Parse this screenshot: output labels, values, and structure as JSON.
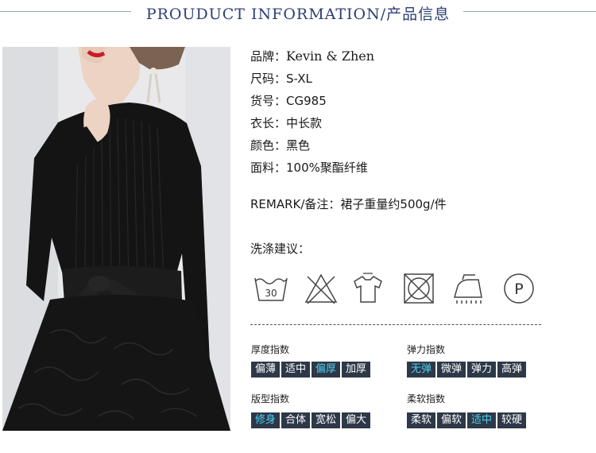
{
  "header": {
    "title": "PROUDUCT INFORMATION/产品信息"
  },
  "specs": [
    {
      "label": "品牌：",
      "value": "Kevin & Zhen"
    },
    {
      "label": "尺码：",
      "value": "S-XL"
    },
    {
      "label": "货号：",
      "value": "CG985"
    },
    {
      "label": "衣长：",
      "value": "中长款"
    },
    {
      "label": "颜色：",
      "value": "黑色"
    },
    {
      "label": "面料：",
      "value": "100%聚酯纤维"
    }
  ],
  "remark": {
    "label": "REMARK/备注：",
    "value": "裙子重量约500g/件"
  },
  "washing": {
    "label": "洗涤建议：",
    "icons": [
      {
        "name": "wash-30-icon",
        "text": "30"
      },
      {
        "name": "no-bleach-icon"
      },
      {
        "name": "dry-flat-icon"
      },
      {
        "name": "no-tumble-dry-icon"
      },
      {
        "name": "low-iron-icon"
      },
      {
        "name": "dry-clean-p-icon",
        "text": "P"
      }
    ]
  },
  "indices": {
    "thickness": {
      "label": "厚度指数",
      "options": [
        "偏薄",
        "适中",
        "偏厚",
        "加厚"
      ],
      "selected": "偏厚"
    },
    "elasticity": {
      "label": "弹力指数",
      "options": [
        "无弹",
        "微弹",
        "弹力",
        "高弹"
      ],
      "selected": "无弹"
    },
    "fit": {
      "label": "版型指数",
      "options": [
        "修身",
        "合体",
        "宽松",
        "偏大"
      ],
      "selected": "修身"
    },
    "softness": {
      "label": "柔软指数",
      "options": [
        "柔软",
        "偏软",
        "适中",
        "较硬"
      ],
      "selected": "适中"
    }
  },
  "colors": {
    "title": "#2c3f74",
    "chip_bg": "#2d3848",
    "chip_active_text": "#4fd0f0"
  }
}
